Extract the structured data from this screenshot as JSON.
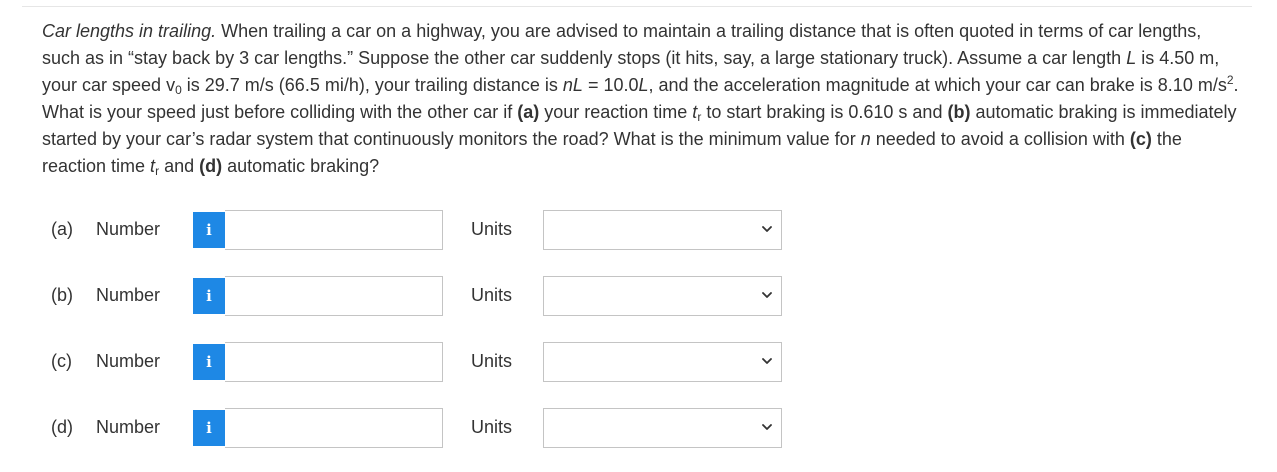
{
  "question": {
    "title": "Car lengths in trailing.",
    "text1": " When trailing a car on a highway, you are advised to maintain a trailing distance that is often quoted in terms of car lengths, such as in “stay back by 3 car lengths.” Suppose the other car suddenly stops (it hits, say, a large stationary truck). Assume a car length ",
    "L_var": "L",
    "text2": " is 4.50 m, your car speed v",
    "v_sub": "0",
    "text3": " is 29.7 m/s (66.5 mi/h), your trailing distance is ",
    "nL_var": "nL",
    "text4": " = 10.0",
    "L_var2": "L",
    "text5": ", and the acceleration magnitude at which your car can brake is 8.10 m/s",
    "sq_sup": "2",
    "text6": ". What is your speed just before colliding with the other car if ",
    "part_a": "(a)",
    "text7": " your reaction time ",
    "t_var": "t",
    "r_sub": "r",
    "text8": " to start braking is 0.610 s and ",
    "part_b": "(b)",
    "text9": " automatic braking is immediately started by your car’s radar system that continuously monitors the road? What is the minimum value for ",
    "n_var": "n",
    "text10": " needed to avoid a collision with ",
    "part_c": "(c)",
    "text11": " the reaction time ",
    "t_var2": "t",
    "r_sub2": "r",
    "text12": " and ",
    "part_d": "(d)",
    "text13": " automatic braking?"
  },
  "rows": [
    {
      "part": "(a)",
      "number_label": "Number",
      "info_glyph": "i",
      "units_label": "Units",
      "value": "",
      "units_selected": ""
    },
    {
      "part": "(b)",
      "number_label": "Number",
      "info_glyph": "i",
      "units_label": "Units",
      "value": "",
      "units_selected": ""
    },
    {
      "part": "(c)",
      "number_label": "Number",
      "info_glyph": "i",
      "units_label": "Units",
      "value": "",
      "units_selected": ""
    },
    {
      "part": "(d)",
      "number_label": "Number",
      "info_glyph": "i",
      "units_label": "Units",
      "value": "",
      "units_selected": ""
    }
  ],
  "colors": {
    "info_button": "#1e88e5",
    "input_border": "#c4c4c4",
    "text": "#333333"
  }
}
